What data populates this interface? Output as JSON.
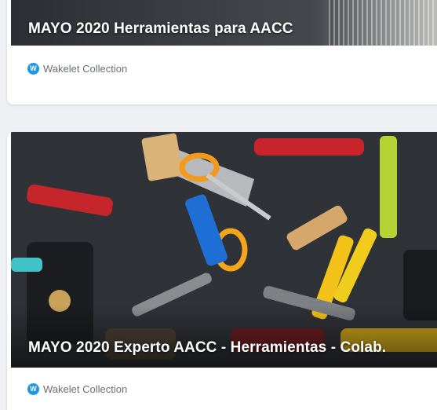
{
  "cards": [
    {
      "title": "MAYO 2020 Herramientas para AACC",
      "type_label": "Wakelet Collection",
      "icon": "wakelet-logo-icon",
      "icon_glyph": "W"
    },
    {
      "title": "MAYO 2020 Experto AACC - Herramientas - Colab.",
      "type_label": "Wakelet Collection",
      "icon": "wakelet-logo-icon",
      "icon_glyph": "W"
    }
  ],
  "colors": {
    "page_background": "#eef0f3",
    "card_background": "#ffffff",
    "wakelet_blue": "#1f95e6",
    "meta_text": "#6b6f75"
  }
}
